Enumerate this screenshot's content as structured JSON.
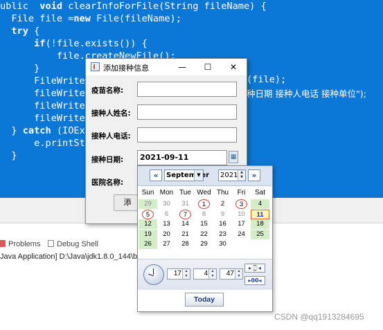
{
  "editor": {
    "lines": [
      "ublic  void clearInfoForFile(String fileName) {",
      "  File file =new File(fileName);",
      "  try {",
      "      if(!file.exists()) {",
      "          file.createNewFile();",
      "      }",
      "      FileWrite",
      "      fileWrite",
      "      fileWrite",
      "      fileWrite",
      "  } catch (IOEx",
      "      e.printSt",
      "  }"
    ],
    "partial_line_6": "(file);",
    "partial_line_7": "种日期 接种人电话 接种单位\");"
  },
  "bottom": {
    "tab_problems": "Problems",
    "tab_debug_shell": "Debug Shell",
    "console_line": "Java Application] D:\\Java\\jdk1.8.0_144\\bin"
  },
  "watermark": "CSDN @qq1913284695",
  "dialog": {
    "title": "添加接种信息",
    "minimize": "—",
    "maximize": "☐",
    "close": "✕",
    "labels": {
      "vaccine": "疫苗名称:",
      "name": "接种人姓名:",
      "phone": "接种人电话:",
      "date": "接种日期:",
      "hospital": "医院名称:"
    },
    "values": {
      "vaccine": "",
      "name": "",
      "phone": "",
      "date": "2021-09-11"
    },
    "add_button": "添"
  },
  "calendar": {
    "prev": "«",
    "next": "»",
    "month": "September",
    "year": "2021",
    "weekdays": [
      "Sun",
      "Mon",
      "Tue",
      "Wed",
      "Thu",
      "Fri",
      "Sat"
    ],
    "weeks": [
      [
        "29",
        "30",
        "31",
        "1",
        "2",
        "3",
        "4"
      ],
      [
        "5",
        "6",
        "7",
        "8",
        "9",
        "10",
        "11"
      ],
      [
        "12",
        "13",
        "14",
        "15",
        "16",
        "17",
        "18"
      ],
      [
        "19",
        "20",
        "21",
        "22",
        "23",
        "24",
        "25"
      ],
      [
        "26",
        "27",
        "28",
        "29",
        "30",
        "",
        ""
      ]
    ],
    "selected_day": "11",
    "hour": "17",
    "minute": "4",
    "second": "47",
    "today": "Today",
    "colors": {
      "weekend": "#d5ecc8",
      "header": "#dbe5f1",
      "circle": "#cc4444"
    }
  },
  "colors": {
    "editor_bg": "#0b78d7"
  }
}
